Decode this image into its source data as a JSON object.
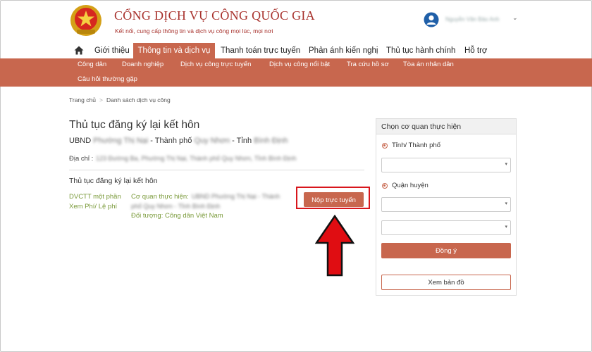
{
  "header": {
    "title": "CỔNG DỊCH VỤ CÔNG QUỐC GIA",
    "subtitle": "Kết nối, cung cấp thông tin và dịch vụ công mọi lúc, mọi nơi",
    "user_name": "Nguyễn Văn Bảo Anh"
  },
  "nav": {
    "items": [
      "Giới thiệu",
      "Thông tin và dịch vụ",
      "Thanh toán trực tuyến",
      "Phản ánh kiến nghị",
      "Thủ tục hành chính",
      "Hỗ trợ"
    ]
  },
  "submenu": {
    "items": [
      "Công dân",
      "Doanh nghiệp",
      "Dịch vụ công trực tuyến",
      "Dịch vụ công nổi bật",
      "Tra cứu hồ sơ",
      "Tòa án nhân dân",
      "Câu hỏi thường gặp"
    ]
  },
  "breadcrumb": {
    "home": "Trang chủ",
    "sep": ">",
    "current": "Danh sách dịch vụ công"
  },
  "main": {
    "title": "Thủ tục đăng ký lại kết hôn",
    "agency_prefix": "UBND",
    "agency_blur1": "Phường Thị Nại",
    "agency_mid": "- Thành phố",
    "agency_blur2": "Quy Nhơn",
    "agency_mid2": "- Tỉnh",
    "agency_blur3": "Bình Định",
    "address_label": "Địa chỉ :",
    "address_value": "123 Đường Ba, Phường Thị Nại, Thành phố Quy Nhơn, Tỉnh Bình Định",
    "section_title": "Thủ tục đăng ký lại kết hôn",
    "dvctt_label": "DVCTT một phần",
    "fee_label": "Xem Phí/ Lệ phí",
    "agency_impl_label": "Cơ quan thực hiện:",
    "agency_impl_value": "UBND Phường Thị Nại - Thành",
    "agency_impl_value2": "phố Quy Nhơn - Tỉnh Bình Định",
    "target_label": "Đối tượng: Công dân Việt Nam",
    "submit_label": "Nộp trực tuyến"
  },
  "panel": {
    "title": "Chọn cơ quan thực hiện",
    "radio_province": "Tỉnh/ Thành phố",
    "radio_district": "Quận huyện",
    "agree_label": "Đồng ý",
    "map_label": "Xem bản đồ"
  },
  "colors": {
    "accent": "#c8674e",
    "brand_red": "#a8322d",
    "highlight_red": "#d8161c",
    "green_text": "#7a9a3a"
  }
}
